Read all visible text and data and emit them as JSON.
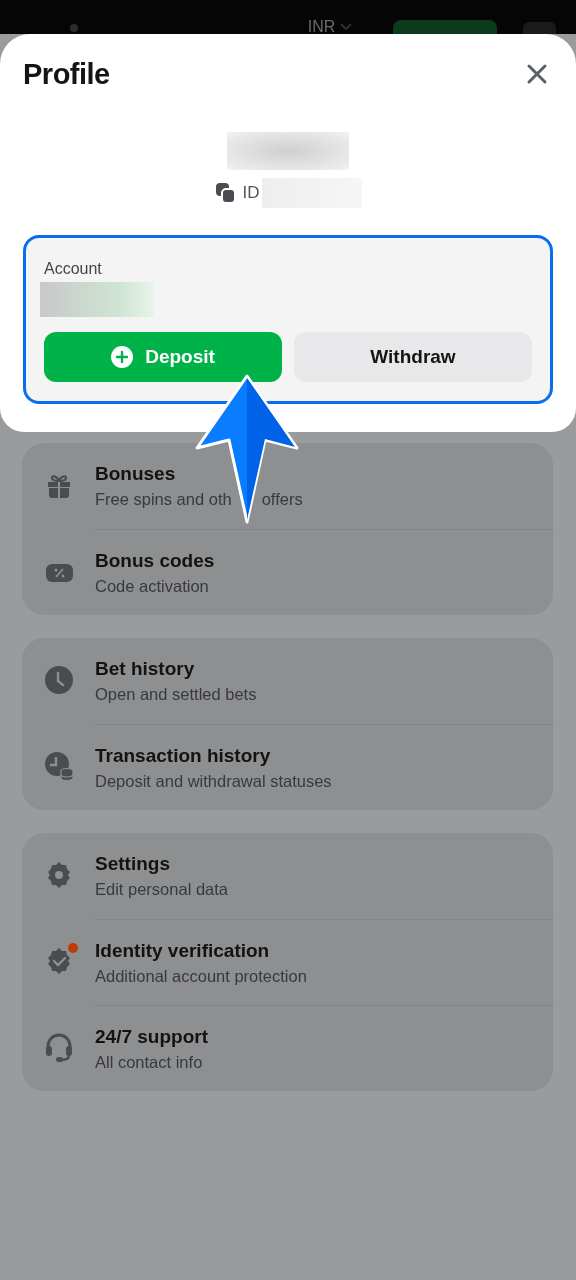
{
  "header": {
    "currency": "INR"
  },
  "sheet": {
    "title": "Profile",
    "id_label": "ID",
    "account": {
      "label": "Account",
      "buttons": [
        {
          "label": "Deposit",
          "kind": "primary"
        },
        {
          "label": "Withdraw",
          "kind": "secondary"
        }
      ]
    }
  },
  "menu_groups": [
    {
      "items": [
        {
          "title": "Bonuses",
          "subtitle": [
            "Free spins and oth",
            "offers"
          ],
          "alert": false
        },
        {
          "title": "Bonus codes",
          "subtitle": "Code activation",
          "alert": false
        }
      ]
    },
    {
      "items": [
        {
          "title": "Bet history",
          "subtitle": "Open and settled bets",
          "alert": false
        },
        {
          "title": "Transaction history",
          "subtitle": "Deposit and withdrawal statuses",
          "alert": false
        }
      ]
    },
    {
      "items": [
        {
          "title": "Settings",
          "subtitle": "Edit personal data",
          "alert": false
        },
        {
          "title": "Identity verification",
          "subtitle": "Additional account protection",
          "alert": true
        },
        {
          "title": "24/7 support",
          "subtitle": "All contact info",
          "alert": false
        }
      ]
    }
  ]
}
